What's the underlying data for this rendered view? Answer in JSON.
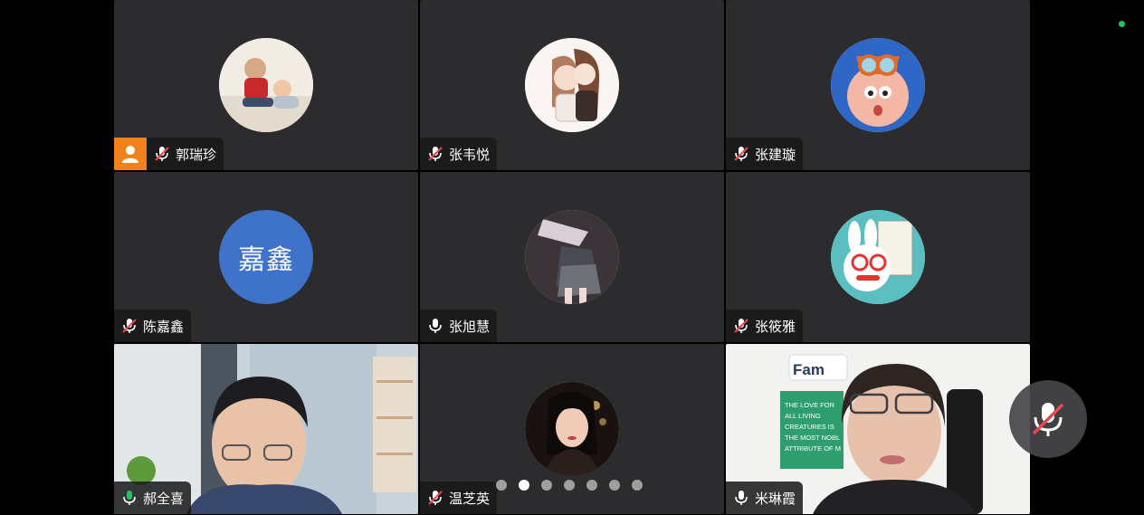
{
  "participants": [
    {
      "name": "郭瑞珍",
      "mic": "muted",
      "avatar_kind": "photo-kids"
    },
    {
      "name": "张韦悦",
      "mic": "muted",
      "avatar_kind": "anime-girls"
    },
    {
      "name": "张建璇",
      "mic": "muted",
      "avatar_kind": "cartoon-doraemon"
    },
    {
      "name": "陈嘉鑫",
      "mic": "muted",
      "avatar_text": "嘉鑫",
      "avatar_color": "#3f73c9"
    },
    {
      "name": "张旭慧",
      "mic": "on",
      "avatar_kind": "anime-dark"
    },
    {
      "name": "张筱雅",
      "mic": "muted",
      "avatar_kind": "rabbit-sign"
    },
    {
      "name": "郝全喜",
      "mic": "active",
      "avatar_kind": "live-video-man"
    },
    {
      "name": "温芝英",
      "mic": "muted",
      "avatar_kind": "photo-woman"
    },
    {
      "name": "米琳霞",
      "mic": "on",
      "avatar_kind": "live-video-woman"
    }
  ],
  "pager": {
    "total": 7,
    "current": 2
  },
  "colors": {
    "tile_bg": "#2c2c2e",
    "active_border": "#23c55e",
    "self_badge": "#f0821e",
    "mute_red": "#e5484d"
  },
  "video_texts": {
    "poster_heading": "Fam",
    "poster_lines": [
      "THE LOVE FOR",
      "ALL LIVING",
      "CREATURES IS",
      "THE MOST NOBL",
      "ATTRIBUTE OF M"
    ]
  },
  "icons": {
    "mic_muted": "mic-muted-icon",
    "mic_on": "mic-icon",
    "floating": "mic-muted-icon"
  }
}
